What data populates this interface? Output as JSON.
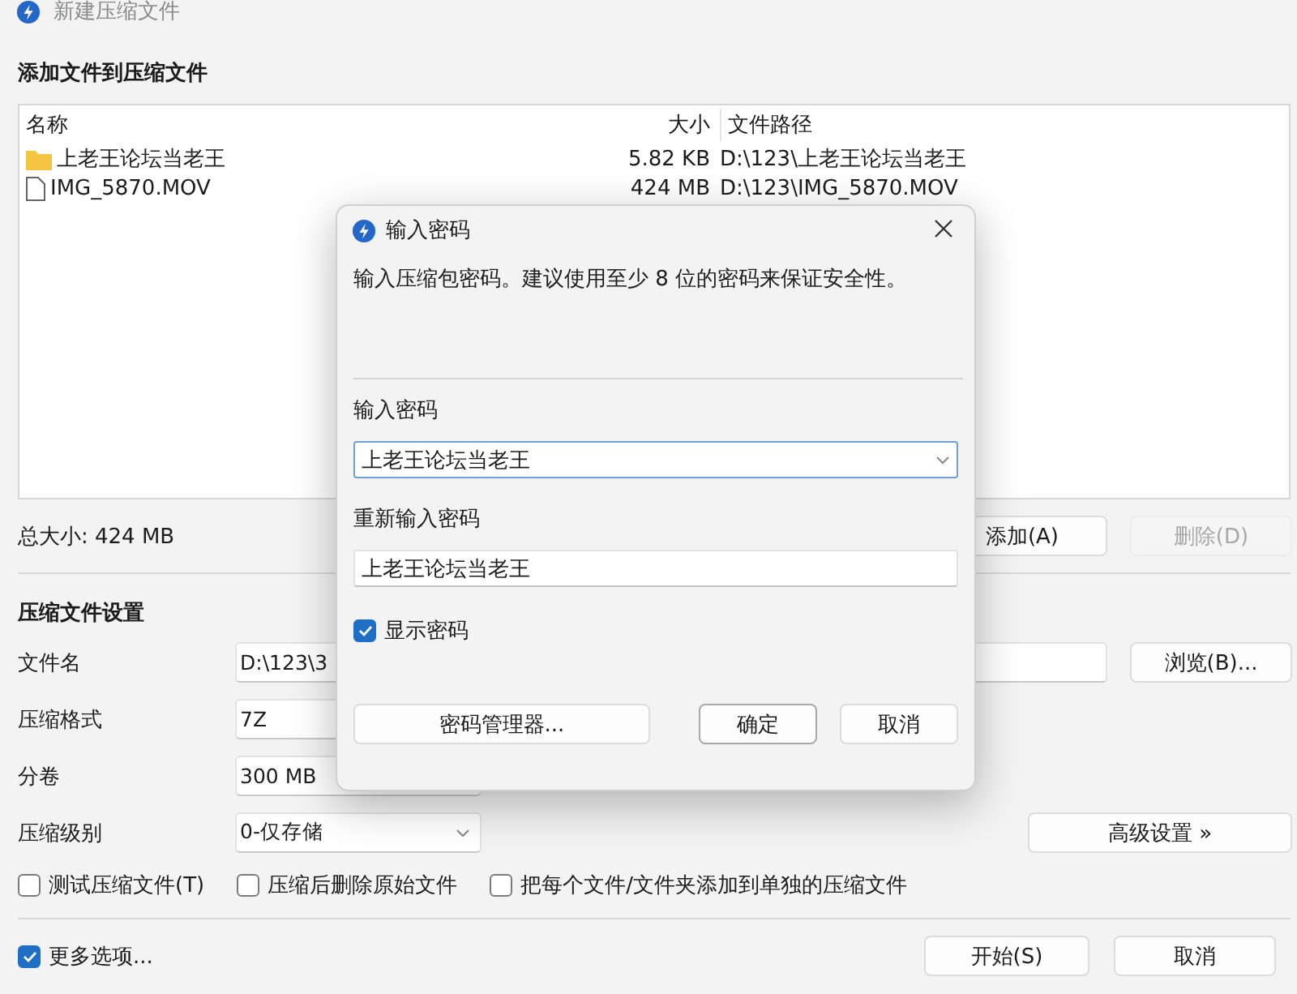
{
  "window": {
    "title": "新建压缩文件"
  },
  "files_section": {
    "heading": "添加文件到压缩文件",
    "columns": [
      "名称",
      "大小",
      "文件路径"
    ],
    "rows": [
      {
        "kind": "folder",
        "name": "上老王论坛当老王",
        "size": "5.82 KB",
        "path": "D:\\123\\上老王论坛当老王"
      },
      {
        "kind": "file",
        "name": "IMG_5870.MOV",
        "size": "424 MB",
        "path": "D:\\123\\IMG_5870.MOV"
      }
    ],
    "total": "总大小: 424 MB",
    "buttons": [
      {
        "label": "添加(A)",
        "disabled": false
      },
      {
        "label": "删除(D)",
        "disabled": true
      }
    ]
  },
  "settings": {
    "heading": "压缩文件设置",
    "fields": [
      {
        "label": "文件名",
        "value": "D:\\123\\3",
        "kind": "text"
      },
      {
        "label": "压缩格式",
        "value": "7Z",
        "kind": "text"
      },
      {
        "label": "分卷",
        "value": "300 MB",
        "kind": "text"
      },
      {
        "label": "压缩级别",
        "value": "0-仅存储",
        "kind": "select"
      }
    ],
    "browse_button": "浏览(B)...",
    "advanced_button": "高级设置 »",
    "options": [
      {
        "label": "测试压缩文件(T)",
        "checked": false
      },
      {
        "label": "压缩后删除原始文件",
        "checked": false
      },
      {
        "label": "把每个文件/文件夹添加到单独的压缩文件",
        "checked": false
      }
    ]
  },
  "footer": {
    "more_options": {
      "label": "更多选项...",
      "checked": true
    },
    "buttons": [
      "开始(S)",
      "取消"
    ]
  },
  "dialog": {
    "title": "输入密码",
    "message": "输入压缩包密码。建议使用至少 8 位的密码来保证安全性。",
    "password_label": "输入密码",
    "password": "上老王论坛当老王",
    "confirm_label": "重新输入密码",
    "confirm": "上老王论坛当老王",
    "show_password": {
      "label": "显示密码",
      "checked": true
    },
    "manager_button": "密码管理器...",
    "ok_button": "确定",
    "cancel_button": "取消"
  }
}
